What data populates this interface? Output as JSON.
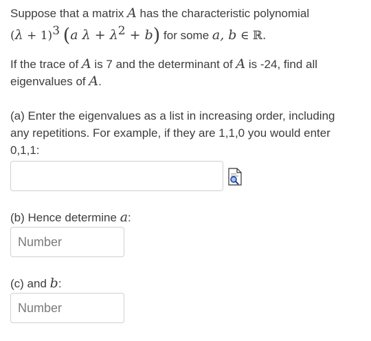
{
  "question": {
    "intro_prefix": "Suppose that a matrix ",
    "matrix_var": "A",
    "intro_suffix": " has the characteristic polynomial",
    "poly_open": "(",
    "poly_lambda1": "λ",
    "poly_plus1": " + 1)",
    "poly_exp": "3",
    "poly_big_open": "(",
    "poly_a": "a",
    "poly_lambda2": " λ + λ",
    "poly_exp2": "2",
    "poly_plus_b": " + b",
    "poly_big_close": ")",
    "for_some": " for some ",
    "vars_ab": "a, b",
    "in_reals": " ∈ ℝ.",
    "trace_prefix": "If the trace of ",
    "trace_mid": " is 7 and the determinant of ",
    "trace_suffix": " is -24, find all",
    "eigen_prefix": "eigenvalues of ",
    "eigen_dot": "."
  },
  "part_a": {
    "line1": "(a) Enter the eigenvalues as a list in increasing order, including",
    "line2": "any repetitions. For example, if they are 1,1,0 you would enter",
    "line3": "0,1,1:",
    "input_value": "",
    "input_placeholder": "",
    "preview_icon": "magnifier-preview-icon"
  },
  "part_b": {
    "label_prefix": "(b) Hence determine ",
    "label_var": "a",
    "label_suffix": ":",
    "placeholder": "Number"
  },
  "part_c": {
    "label_prefix": "(c) and ",
    "label_var": "b",
    "label_suffix": ":",
    "placeholder": "Number"
  }
}
